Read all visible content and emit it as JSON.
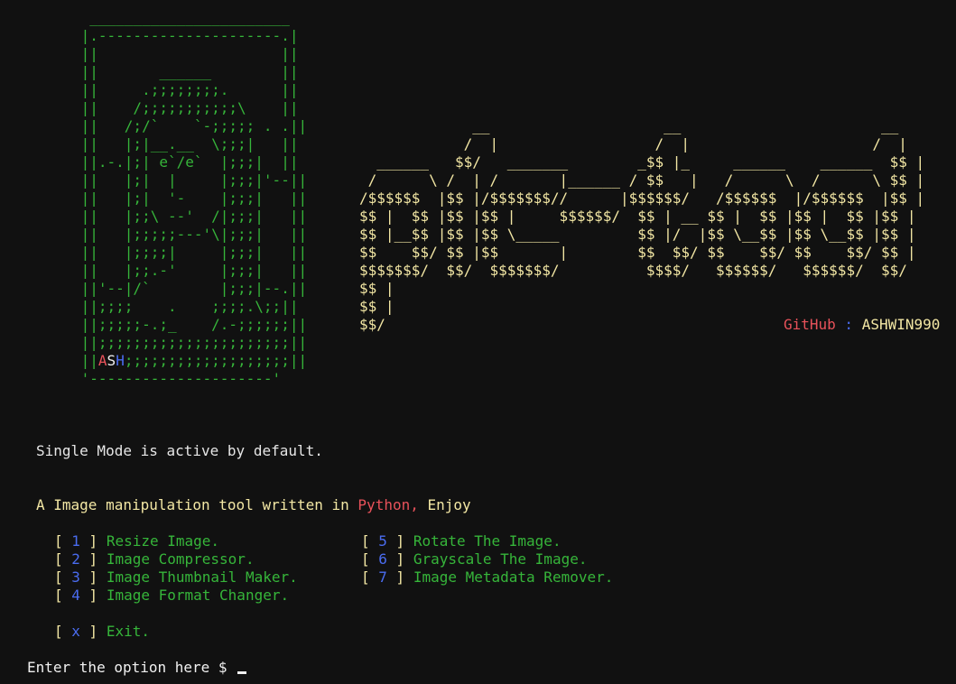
{
  "ascii_frame": [
    "  _______________________",
    " |.---------------------.|",
    " ||                     ||",
    " ||       ______        ||",
    " ||     .;;;;;;;;.      ||",
    " ||    /;;;;;;;;;;;\\    ||",
    " ||   /;/`    `-;;;;; . .||",
    " ||   |;|__.__  \\;;;|   ||",
    " ||.-.|;| e`/e`  |;;;|  ||",
    " ||   |;|  |     |;;;|'--||",
    " ||   |;|  '-    |;;;|   ||",
    " ||   |;;\\ --'  /|;;;|   ||",
    " ||   |;;;;;---'\\|;;;|   ||",
    " ||   |;;;;|     |;;;|   ||",
    " ||   |;;.-'     |;;;|   ||",
    " ||'--|/`        |;;;|--.||",
    " ||;;;;    .    ;;;;.\\;;||",
    " ||;;;;;-.;_    /.-;;;;;;||",
    " ||;;;;;;;;;;;;;;;;;;;;;;||"
  ],
  "ascii_bottom_line": " '---------------------'",
  "tag": {
    "prefix": " ||",
    "a": "A",
    "s": "S",
    "h": "H",
    "rest": ";;;;;;;;;;;;;;;;;;;||"
  },
  "banner": [
    "             __                    __                       __",
    "            /  |                  /  |                     /  |",
    "  ______   $$/   _______        _$$ |_     ______    ______  $$ |",
    " /      \\ /  | /       |______ / $$   |   /      \\  /      \\ $$ |",
    "/$$$$$$  |$$ |/$$$$$$$//      |$$$$$$/   /$$$$$$  |/$$$$$$  |$$ |",
    "$$ |  $$ |$$ |$$ |     $$$$$$/  $$ | __ $$ |  $$ |$$ |  $$ |$$ |",
    "$$ |__$$ |$$ |$$ \\_____         $$ |/  |$$ \\__$$ |$$ \\__$$ |$$ |",
    "$$    $$/ $$ |$$       |        $$  $$/ $$    $$/ $$    $$/ $$ |",
    "$$$$$$$/  $$/  $$$$$$$/          $$$$/   $$$$$$/   $$$$$$/  $$/",
    "$$ |",
    "$$ |",
    "$$/"
  ],
  "github": {
    "label": "GitHub",
    "sep": " : ",
    "user": "ASHWIN990"
  },
  "status": "Single Mode is active by default.",
  "intro": {
    "before": "A Image manipulation tool written in ",
    "lang": "Python,",
    "after": " Enjoy"
  },
  "menu_left": [
    {
      "key": "1",
      "label": "Resize Image."
    },
    {
      "key": "2",
      "label": "Image Compressor."
    },
    {
      "key": "3",
      "label": "Image Thumbnail Maker."
    },
    {
      "key": "4",
      "label": "Image Format Changer."
    }
  ],
  "menu_right": [
    {
      "key": "5",
      "label": "Rotate The Image."
    },
    {
      "key": "6",
      "label": "Grayscale The Image."
    },
    {
      "key": "7",
      "label": "Image Metadata Remover."
    }
  ],
  "exit": {
    "key": "x",
    "label": "Exit."
  },
  "prompt": "Enter the option here $ ",
  "colors": {
    "background": "#111111",
    "frame_green": "#36b53a",
    "banner_yellow": "#f3e7a4",
    "accent_red": "#e8525a",
    "accent_blue": "#4a6cf0"
  }
}
